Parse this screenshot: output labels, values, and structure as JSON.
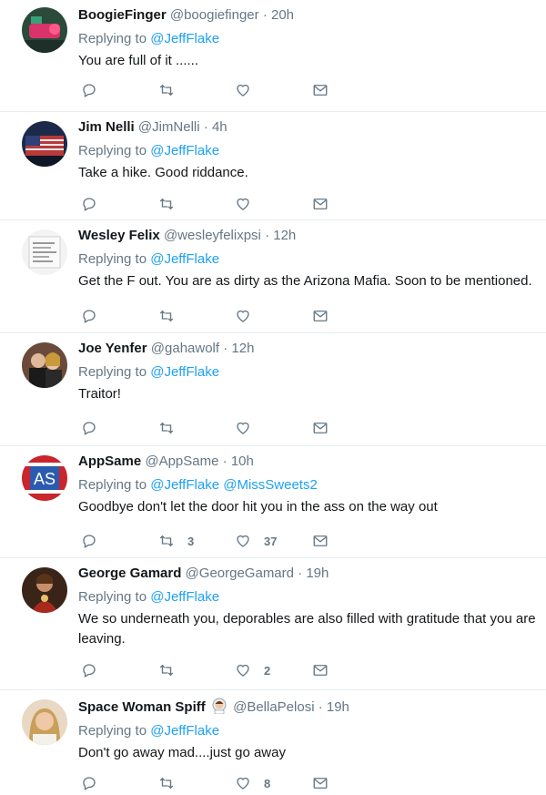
{
  "replying_prefix": "Replying to",
  "colors": {
    "link": "#1da1f2",
    "muted": "#657786",
    "text": "#14171a",
    "divider": "#e6ecf0"
  },
  "tweets": [
    {
      "name": "BoogieFinger",
      "handle": "@boogiefinger",
      "time": "20h",
      "replying_to": [
        "@JeffFlake"
      ],
      "text": "You are full of it ......",
      "retweets": "",
      "likes": ""
    },
    {
      "name": "Jim Nelli",
      "handle": "@JimNelli",
      "time": "4h",
      "replying_to": [
        "@JeffFlake"
      ],
      "text": "Take a hike. Good riddance.",
      "retweets": "",
      "likes": ""
    },
    {
      "name": "Wesley Felix",
      "handle": "@wesleyfelixpsi",
      "time": "12h",
      "replying_to": [
        "@JeffFlake"
      ],
      "text": "Get the F out. You are as dirty as the Arizona Mafia. Soon to be mentioned.",
      "retweets": "",
      "likes": ""
    },
    {
      "name": "Joe Yenfer",
      "handle": "@gahawolf",
      "time": "12h",
      "replying_to": [
        "@JeffFlake"
      ],
      "text": "Traitor!",
      "retweets": "",
      "likes": ""
    },
    {
      "name": "AppSame",
      "handle": "@AppSame",
      "time": "10h",
      "replying_to": [
        "@JeffFlake",
        "@MissSweets2"
      ],
      "text": "Goodbye don't let the door hit you in the ass on the way out",
      "retweets": "3",
      "likes": "37",
      "avatar_text": "AS"
    },
    {
      "name": "George Gamard",
      "handle": "@GeorgeGamard",
      "time": "19h",
      "replying_to": [
        "@JeffFlake"
      ],
      "text": "We so underneath you, deporables are also filled with gratitude that you are leaving.",
      "retweets": "",
      "likes": "2"
    },
    {
      "name": "Space Woman Spiff",
      "handle": "@BellaPelosi",
      "time": "19h",
      "replying_to": [
        "@JeffFlake"
      ],
      "text": "Don't go away mad....just go away",
      "retweets": "",
      "likes": "8",
      "name_emoji": "woman-astronaut-icon"
    }
  ]
}
